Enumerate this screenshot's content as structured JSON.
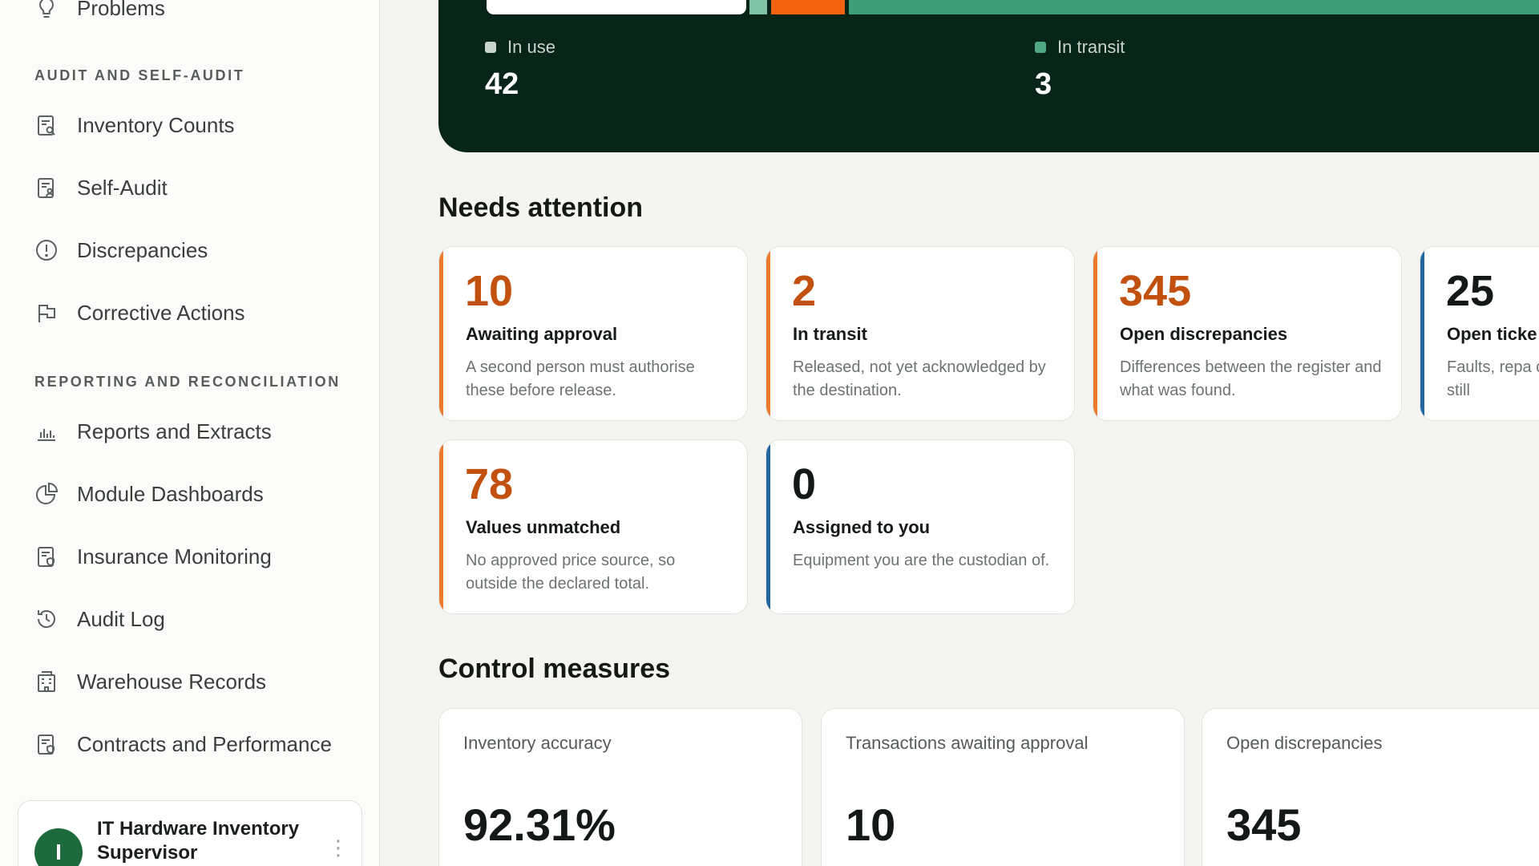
{
  "sidebar": {
    "top_item": "Problems",
    "sections": [
      {
        "label": "AUDIT AND SELF-AUDIT",
        "items": [
          {
            "label": "Inventory Counts",
            "icon": "clipboard-search-icon"
          },
          {
            "label": "Self-Audit",
            "icon": "clipboard-user-icon"
          },
          {
            "label": "Discrepancies",
            "icon": "alert-circle-icon"
          },
          {
            "label": "Corrective Actions",
            "icon": "flag-icon"
          }
        ]
      },
      {
        "label": "REPORTING AND RECONCILIATION",
        "items": [
          {
            "label": "Reports and Extracts",
            "icon": "bar-chart-icon"
          },
          {
            "label": "Module Dashboards",
            "icon": "pie-chart-icon"
          },
          {
            "label": "Insurance Monitoring",
            "icon": "clipboard-shield-icon"
          },
          {
            "label": "Audit Log",
            "icon": "history-icon"
          },
          {
            "label": "Warehouse Records",
            "icon": "building-icon"
          },
          {
            "label": "Contracts and Performance",
            "icon": "clipboard-shield-icon"
          }
        ]
      }
    ],
    "user": {
      "initial": "I",
      "name": "IT Hardware Inventory Supervisor"
    }
  },
  "hero": {
    "legend": [
      {
        "label": "In use",
        "value": "42",
        "color": "#c8d4cd"
      },
      {
        "label": "In transit",
        "value": "3",
        "color": "#4fa882"
      }
    ],
    "bar_colors": {
      "white": "#ffffff",
      "light_green": "#7fc2a4",
      "orange": "#f2620f",
      "green": "#3e9e78"
    }
  },
  "needs_attention": {
    "title": "Needs attention",
    "cards": [
      {
        "value": "10",
        "label": "Awaiting approval",
        "desc": "A second person must authorise these before release.",
        "accent": "#ec7a2c",
        "value_color": "#c2500f"
      },
      {
        "value": "2",
        "label": "In transit",
        "desc": "Released, not yet acknowledged by the destination.",
        "accent": "#ec7a2c",
        "value_color": "#c2500f"
      },
      {
        "value": "345",
        "label": "Open discrepancies",
        "desc": "Differences between the register and what was found.",
        "accent": "#ec7a2c",
        "value_color": "#c2500f"
      },
      {
        "value": "25",
        "label": "Open ticke",
        "desc": "Faults, repa claims still",
        "accent": "#1f66a3",
        "value_color": "#141916"
      },
      {
        "value": "78",
        "label": "Values unmatched",
        "desc": "No approved price source, so outside the declared total.",
        "accent": "#ec7a2c",
        "value_color": "#c2500f"
      },
      {
        "value": "0",
        "label": "Assigned to you",
        "desc": "Equipment you are the custodian of.",
        "accent": "#1f66a3",
        "value_color": "#141916"
      }
    ]
  },
  "control_measures": {
    "title": "Control measures",
    "cards": [
      {
        "label": "Inventory accuracy",
        "value": "92.31%"
      },
      {
        "label": "Transactions awaiting approval",
        "value": "10"
      },
      {
        "label": "Open discrepancies",
        "value": "345"
      }
    ]
  }
}
